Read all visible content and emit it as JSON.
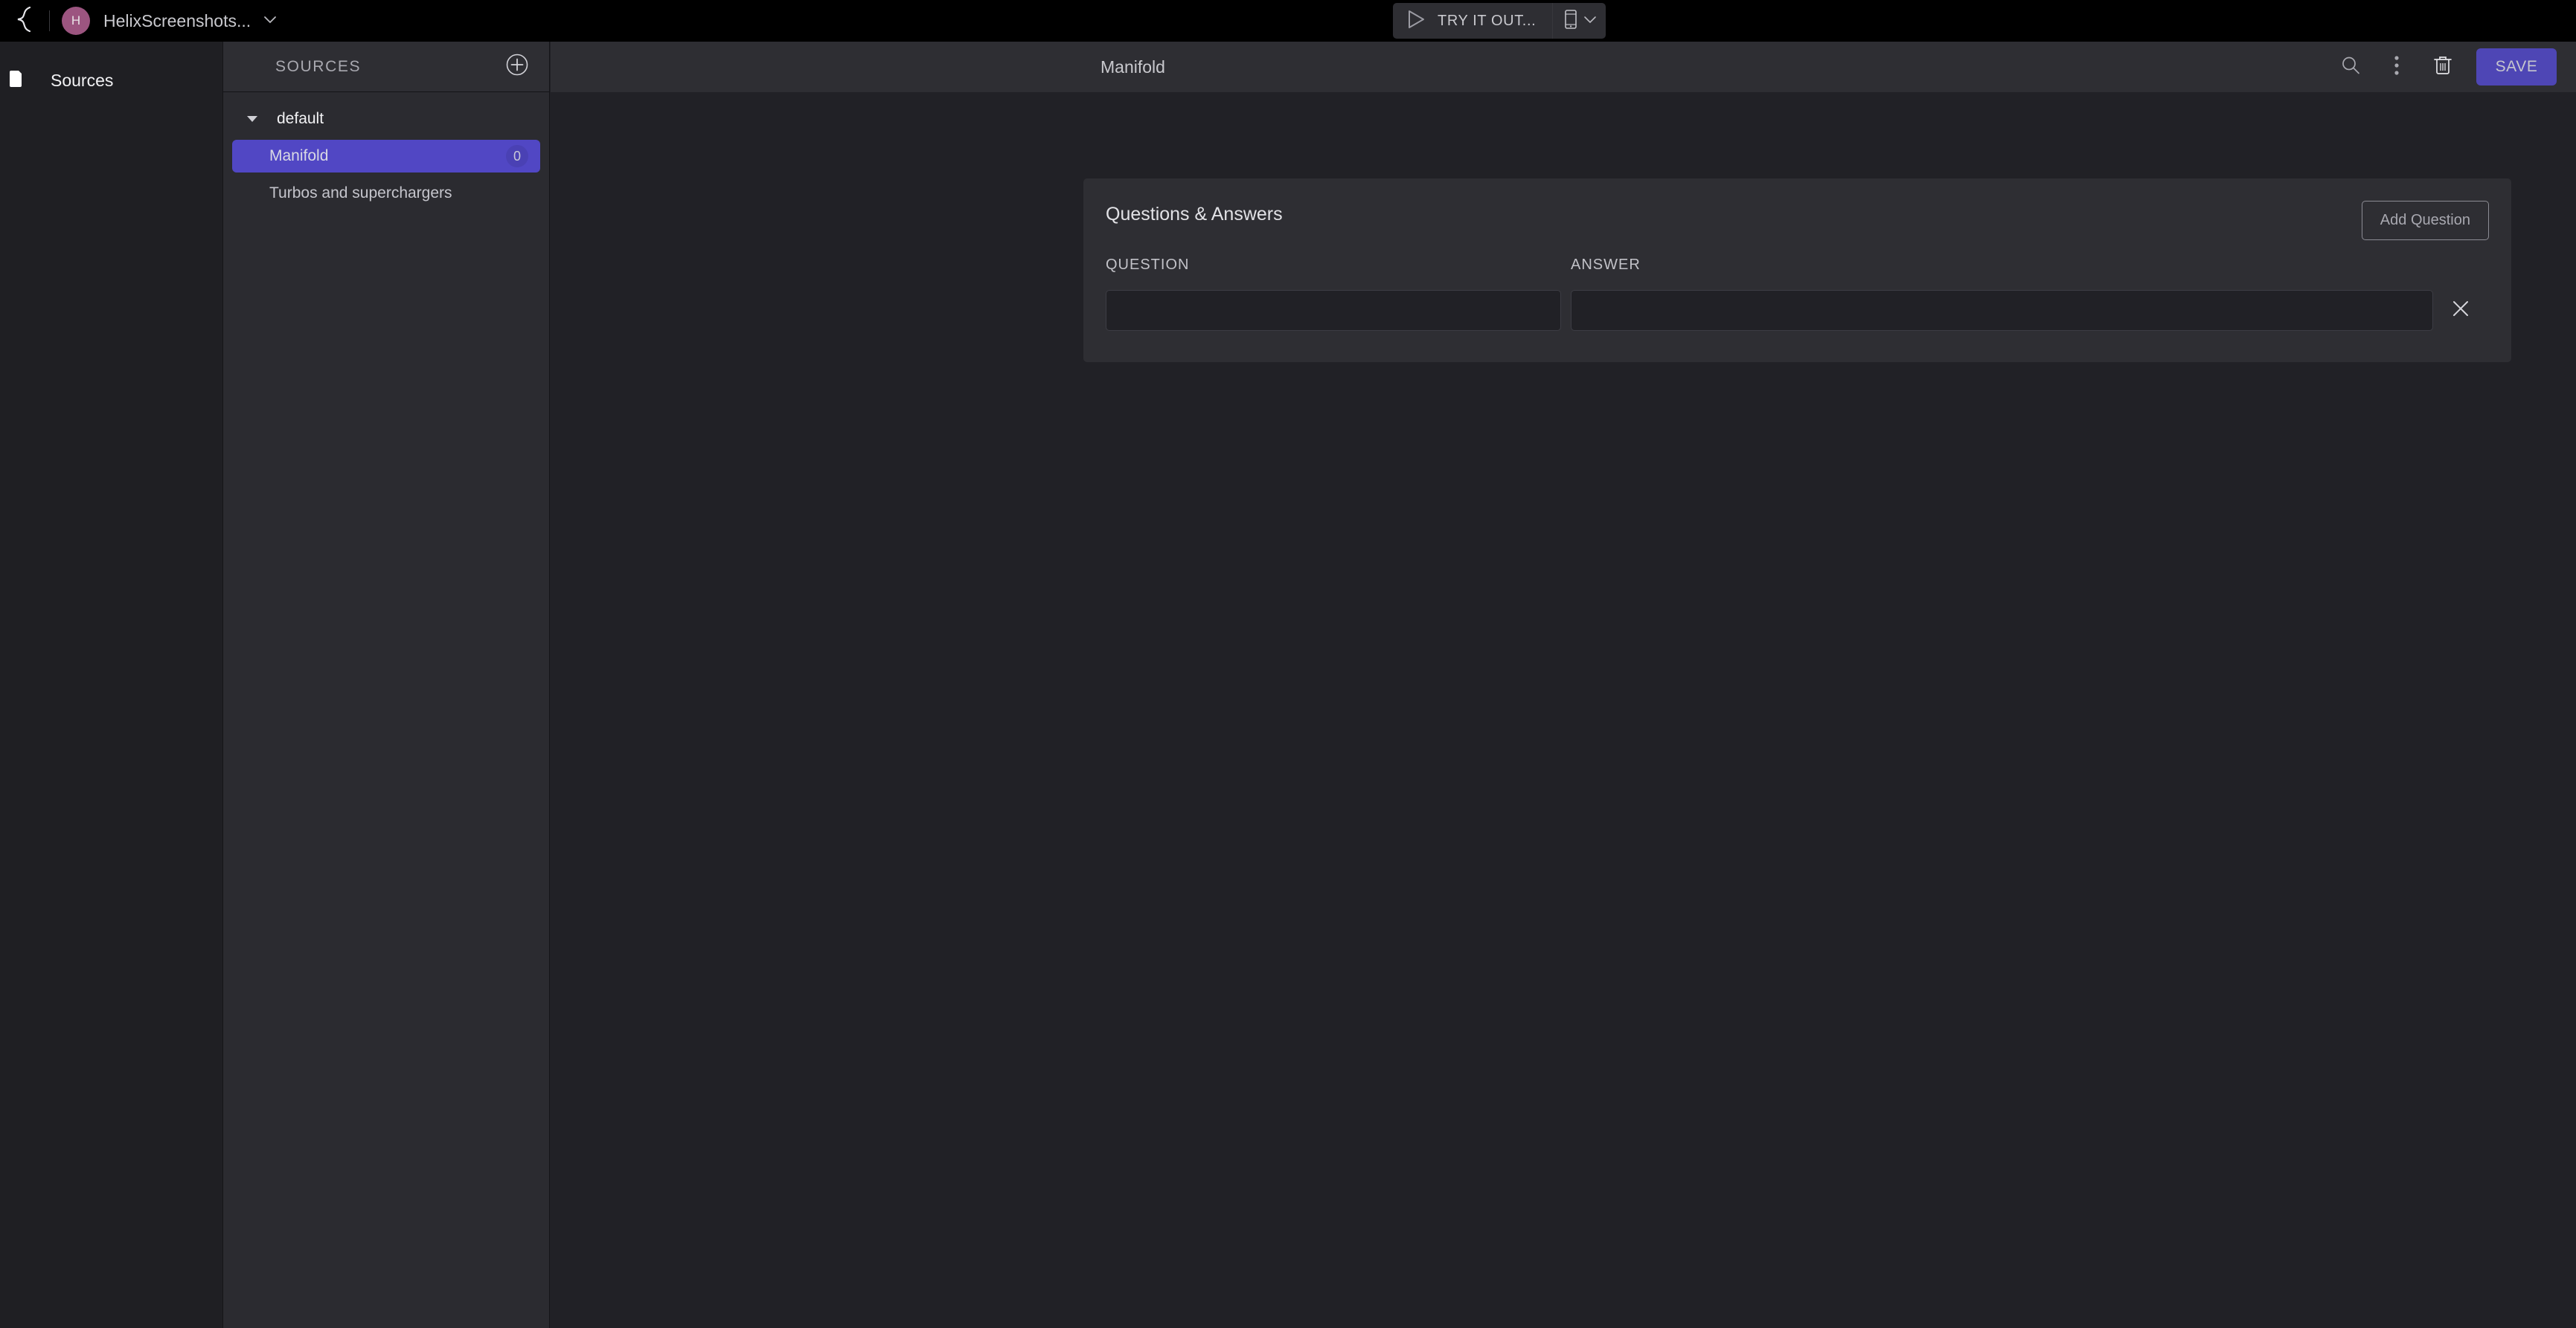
{
  "topbar": {
    "logo_icon": "helix-logo-icon",
    "avatar_initial": "H",
    "org_name": "HelixScreenshots...",
    "org_chevron_icon": "chevron-down-icon",
    "tryout": {
      "play_icon": "play-icon",
      "label": "TRY IT OUT...",
      "device_icon": "mobile-device-icon",
      "device_chevron_icon": "chevron-down-icon"
    }
  },
  "rail": {
    "items": [
      {
        "label": "Sources",
        "icon": "folder-icon"
      }
    ]
  },
  "sources_panel": {
    "header": {
      "title": "SOURCES",
      "add_icon": "plus-circle-icon"
    },
    "tree": {
      "group_label": "default",
      "group_caret_icon": "caret-down-icon",
      "items": [
        {
          "label": "Manifold",
          "badge": "0",
          "selected": true
        },
        {
          "label": "Turbos and superchargers",
          "badge": "",
          "selected": false
        }
      ]
    }
  },
  "content_header": {
    "title": "Manifold",
    "search_icon": "search-icon",
    "more_icon": "more-vertical-icon",
    "delete_icon": "trash-icon",
    "save_label": "SAVE"
  },
  "qa_card": {
    "title": "Questions & Answers",
    "add_question_label": "Add Question",
    "question_label": "QUESTION",
    "answer_label": "ANSWER",
    "remove_icon": "close-icon",
    "rows": [
      {
        "question_value": "",
        "answer_value": ""
      }
    ]
  },
  "colors": {
    "accent_purple": "#5147c4",
    "save_purple": "#4e46b5",
    "avatar_plum": "#9c5580",
    "topbar_black": "#000000",
    "panel_bg": "#2e2e33",
    "content_bg": "#212126"
  }
}
